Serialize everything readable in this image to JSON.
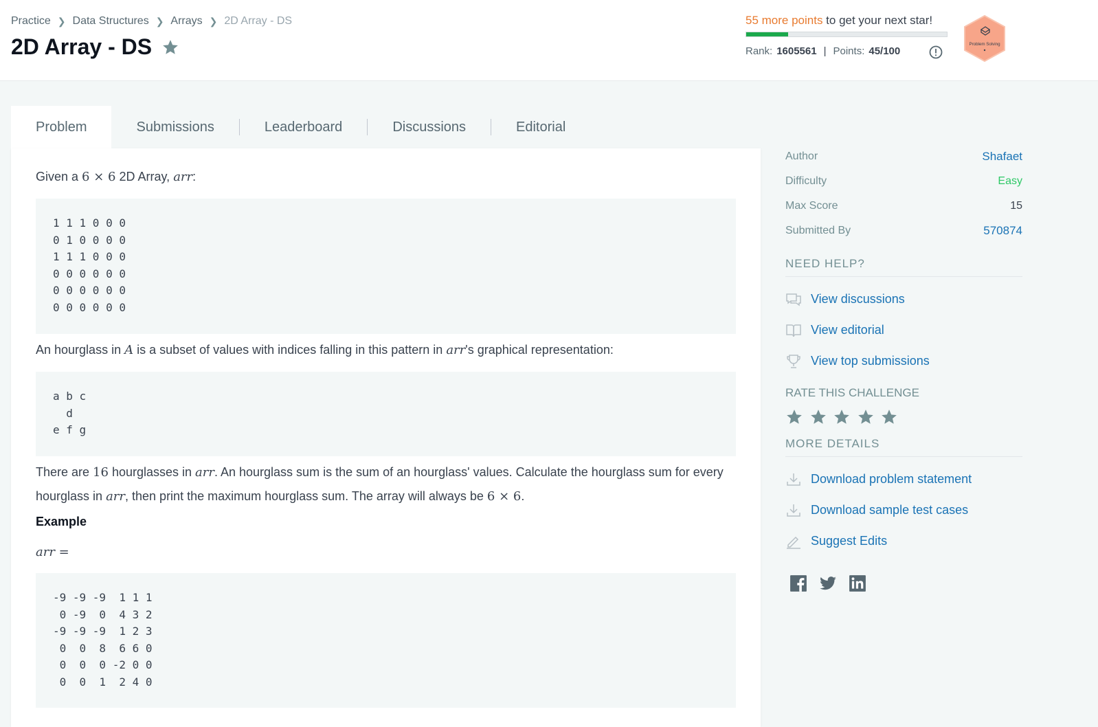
{
  "breadcrumb": {
    "items": [
      "Practice",
      "Data Structures",
      "Arrays"
    ],
    "current": "2D Array - DS"
  },
  "page_title": "2D Array - DS",
  "progress": {
    "points_needed": "55 more points",
    "suffix": " to get your next star!",
    "fraction": 0.21,
    "rank_label": "Rank:",
    "rank_value": "1605561",
    "points_label": "Points:",
    "points_value": "45/100"
  },
  "badge": {
    "label": "Problem Solving"
  },
  "tabs": [
    {
      "label": "Problem",
      "active": true
    },
    {
      "label": "Submissions"
    },
    {
      "label": "Leaderboard"
    },
    {
      "label": "Discussions"
    },
    {
      "label": "Editorial"
    }
  ],
  "problem": {
    "intro_pre": "Given a ",
    "intro_dims": "6 × 6",
    "intro_mid": " 2D Array, ",
    "intro_var": "arr",
    "intro_post": ":",
    "grid1": "1 1 1 0 0 0\n0 1 0 0 0 0\n1 1 1 0 0 0\n0 0 0 0 0 0\n0 0 0 0 0 0\n0 0 0 0 0 0",
    "hourglass_pre": "An hourglass in ",
    "hourglass_A": "A",
    "hourglass_mid": " is a subset of values with indices falling in this pattern in ",
    "hourglass_var": "arr",
    "hourglass_post": "'s graphical representation:",
    "pattern": "a b c\n  d\ne f g",
    "desc_p1": "There are ",
    "desc_count": "16",
    "desc_p2": " hourglasses in ",
    "desc_var1": "arr",
    "desc_p3": ". An hourglass sum is the sum of an hourglass' values. Calculate the hourglass sum for every",
    "desc_p4": "hourglass in ",
    "desc_var2": "arr",
    "desc_p5": ", then print the maximum hourglass sum. The array will always be ",
    "desc_dims": "6 × 6",
    "desc_p6": ".",
    "example_heading": "Example",
    "example_var": "arr =",
    "grid2": "-9 -9 -9  1 1 1\n 0 -9  0  4 3 2\n-9 -9 -9  1 2 3\n 0  0  8  6 6 0\n 0  0  0 -2 0 0\n 0  0  1  2 4 0"
  },
  "sidebar": {
    "meta": [
      {
        "label": "Author",
        "value": "Shafaet"
      },
      {
        "label": "Difficulty",
        "value": "Easy"
      },
      {
        "label": "Max Score",
        "value": "15"
      },
      {
        "label": "Submitted By",
        "value": "570874"
      }
    ],
    "need_help_title": "NEED HELP?",
    "help_links": [
      {
        "label": "View discussions",
        "icon": "discussions-icon"
      },
      {
        "label": "View editorial",
        "icon": "book-icon"
      },
      {
        "label": "View top submissions",
        "icon": "trophy-icon"
      }
    ],
    "rate_title": "RATE THIS CHALLENGE",
    "rating_stars": 5,
    "more_details_title": "MORE DETAILS",
    "detail_links": [
      {
        "label": "Download problem statement",
        "icon": "download-icon"
      },
      {
        "label": "Download sample test cases",
        "icon": "download-icon"
      },
      {
        "label": "Suggest Edits",
        "icon": "pencil-icon"
      }
    ],
    "social": [
      "facebook-icon",
      "twitter-icon",
      "linkedin-icon"
    ]
  },
  "colors": {
    "link": "#1a73b5",
    "easy": "#2ec866",
    "progress_fill": "#1ba94c",
    "points_orange": "#e87b30",
    "icon_gray": "#738f93",
    "badge_fill": "#f7a589"
  }
}
